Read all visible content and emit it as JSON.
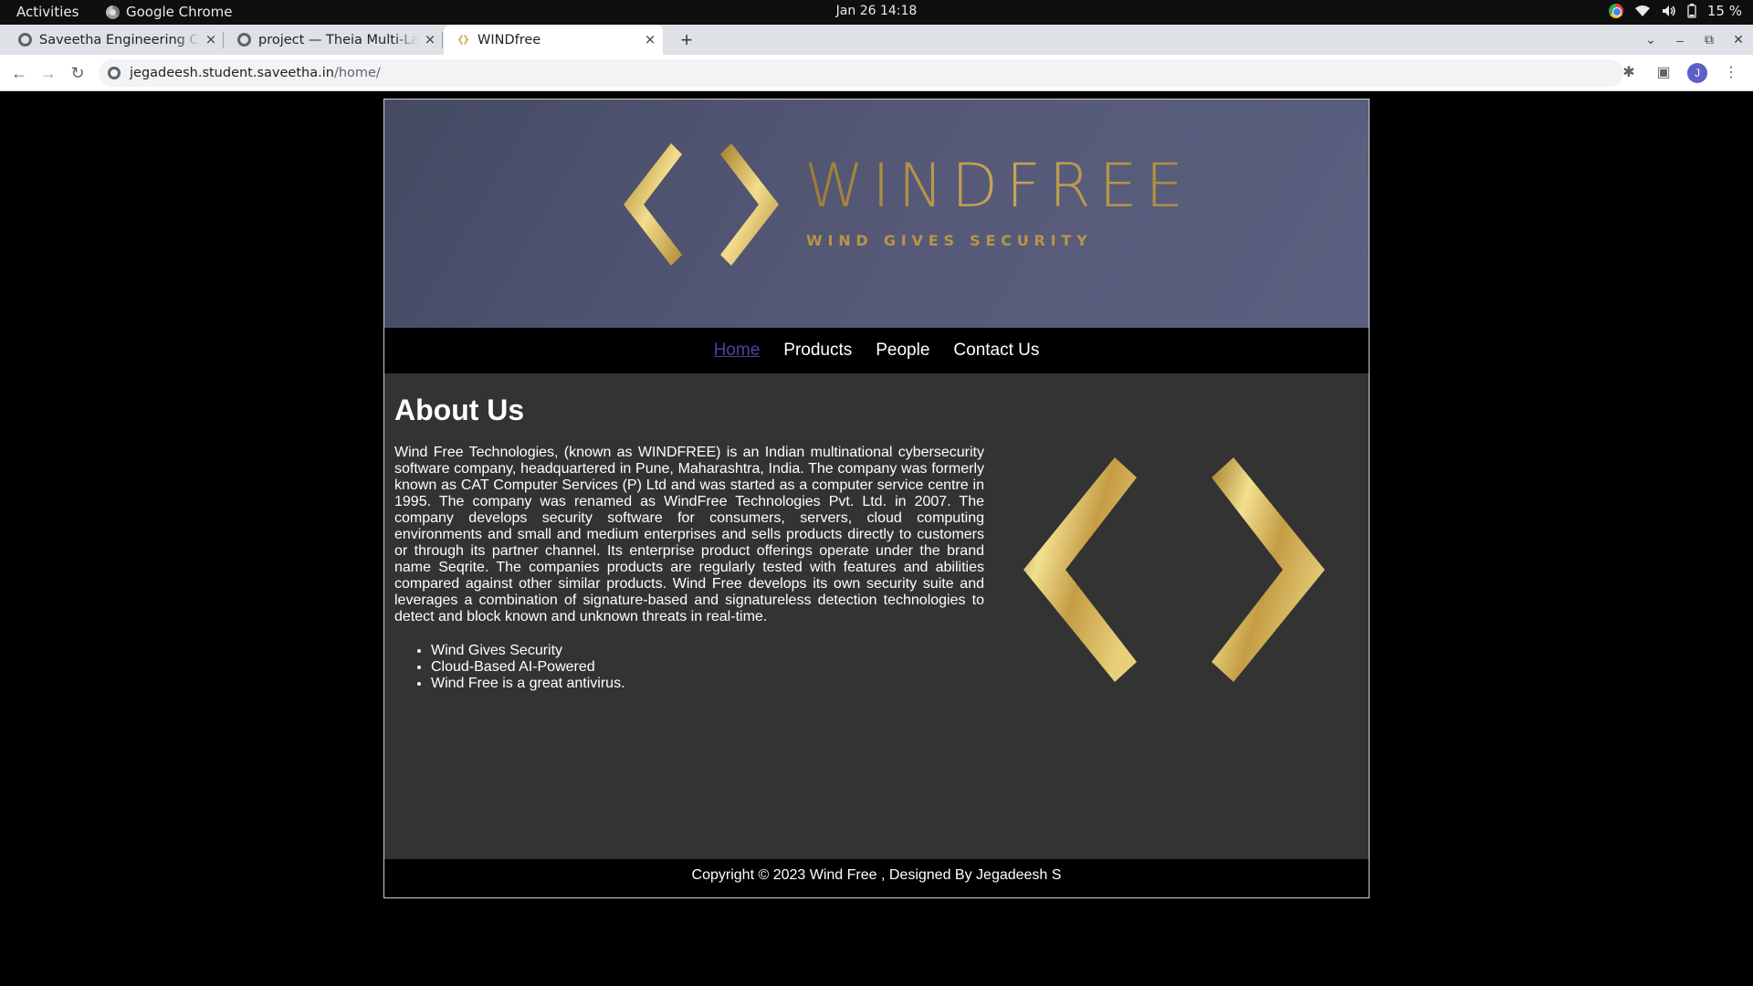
{
  "system_bar": {
    "activities": "Activities",
    "app_name": "Google Chrome",
    "clock": "Jan 26  14:18",
    "battery": "15 %"
  },
  "tabs": [
    {
      "title": "Saveetha Engineering College",
      "close": "×"
    },
    {
      "title": "project — Theia Multi-Language",
      "close": "×"
    },
    {
      "title": "WINDfree",
      "close": "×"
    }
  ],
  "tabstrip": {
    "new_tab": "+"
  },
  "toolbar": {
    "url_host": "jegadeesh.student.saveetha.in",
    "url_path": "/home/",
    "avatar_initial": "J"
  },
  "banner": {
    "wordmark": "WINDFREE",
    "tagline": "WIND GIVES SECURITY"
  },
  "nav": {
    "home": "Home",
    "products": "Products",
    "people": "People",
    "contact": "Contact Us"
  },
  "about": {
    "heading": "About Us",
    "body": "Wind Free Technologies, (known as WINDFREE) is an Indian multinational cybersecurity software company, headquartered in Pune, Maharashtra, India. The company was formerly known as CAT Computer Services (P) Ltd and was started as a computer service centre in 1995. The company was renamed as WindFree Technologies Pvt. Ltd. in 2007. The company develops security software for consumers, servers, cloud computing environments and small and medium enterprises and sells products directly to customers or through its partner channel. Its enterprise product offerings operate under the brand name Seqrite. The companies products are regularly tested with features and abilities compared against other similar products. Wind Free develops its own security suite and leverages a combination of signature-based and signatureless detection technologies to detect and block known and unknown threats in real-time.",
    "bullets": [
      "Wind Gives Security",
      "Cloud-Based AI-Powered",
      "Wind Free is a great antivirus."
    ]
  },
  "footer": {
    "text": "Copyright © 2023 Wind Free , Designed By Jegadeesh S"
  },
  "colors": {
    "gold": "#c9a457",
    "banner_bg": "#565a78",
    "content_bg": "#333333",
    "link_visited": "#5a3aa6"
  },
  "icons": [
    "chrome-icon",
    "wifi-icon",
    "volume-icon",
    "battery-icon",
    "globe-icon",
    "back-icon",
    "forward-icon",
    "reload-icon",
    "site-info-icon",
    "extensions-icon",
    "side-panel-icon",
    "menu-icon",
    "windfree-logo-icon"
  ]
}
